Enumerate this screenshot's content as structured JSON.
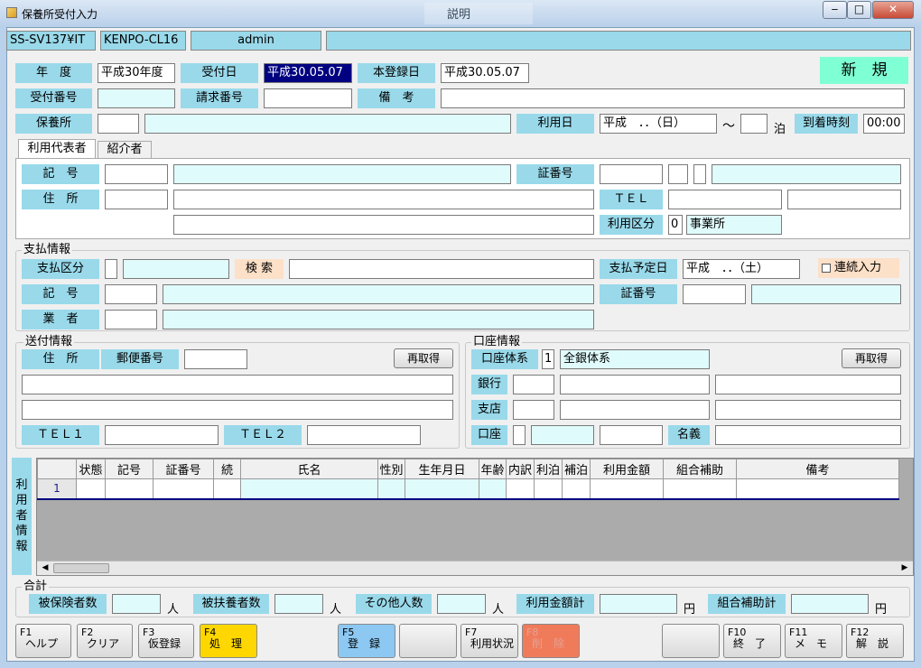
{
  "window": {
    "title": "保養所受付入力",
    "bg_text": "説明"
  },
  "status_bar": {
    "server": "SS-SV137¥IT",
    "client": "KENPO-CL16",
    "user": "admin"
  },
  "header": {
    "year_label": "年　度",
    "year_value": "平成30年度",
    "recv_date_label": "受付日",
    "recv_date_value": "平成30.05.07",
    "reg_date_label": "本登録日",
    "reg_date_value": "平成30.05.07",
    "mode_badge": "新　規",
    "recv_no_label": "受付番号",
    "claim_no_label": "請求番号",
    "note_label": "備　考",
    "facility_label": "保養所",
    "use_date_label": "利用日",
    "use_date_value": "平成　．．（日）",
    "tilde": "～",
    "nights_unit": "泊",
    "arrival_label": "到着時刻",
    "arrival_value": "00:00"
  },
  "tabs": [
    "利用代表者",
    "紹介者"
  ],
  "representative": {
    "symbol_label": "記　号",
    "cert_label": "証番号",
    "address_label": "住　所",
    "tel_label": "ＴＥＬ",
    "use_type_label": "利用区分",
    "use_type_code": "0",
    "use_type_name": "事業所"
  },
  "payment": {
    "group_title": "支払情報",
    "pay_type_label": "支払区分",
    "search_label": "検 索",
    "sched_label": "支払予定日",
    "sched_value": "平成　．．（土）",
    "continuous_label": "連続入力",
    "symbol_label": "記　号",
    "cert_label": "証番号",
    "vendor_label": "業　者"
  },
  "shipping": {
    "group_title": "送付情報",
    "address_label": "住　所",
    "postal_label": "郵便番号",
    "refetch_label": "再取得",
    "tel1_label": "ＴＥＬ１",
    "tel2_label": "ＴＥＬ２"
  },
  "account": {
    "group_title": "口座情報",
    "system_label": "口座体系",
    "system_code": "1",
    "system_name": "全銀体系",
    "refetch_label": "再取得",
    "bank_label": "銀行",
    "branch_label": "支店",
    "account_label": "口座",
    "holder_label": "名義"
  },
  "users": {
    "side_label": "利用者情報",
    "columns": [
      "状態",
      "記号",
      "証番号",
      "続",
      "氏名",
      "性別",
      "生年月日",
      "年齢",
      "内訳",
      "利泊",
      "補泊",
      "利用金額",
      "組合補助",
      "備考"
    ],
    "rows": [
      {
        "no": "1"
      }
    ]
  },
  "totals": {
    "group_title": "合計",
    "insured_label": "被保険者数",
    "dependents_label": "被扶養者数",
    "others_label": "その他人数",
    "person_unit": "人",
    "amount_label": "利用金額計",
    "subsidy_label": "組合補助計",
    "yen_unit": "円"
  },
  "fkeys": [
    {
      "key": "F1",
      "label": "ヘルプ"
    },
    {
      "key": "F2",
      "label": "クリア"
    },
    {
      "key": "F3",
      "label": "仮登録"
    },
    {
      "key": "F4",
      "label": "処　理"
    },
    {
      "key": "F5",
      "label": "登　録"
    },
    {
      "key": "F7",
      "label": "利用状況"
    },
    {
      "key": "F8",
      "label": "削　除"
    },
    {
      "key": "F10",
      "label": "終　了"
    },
    {
      "key": "F11",
      "label": "メ　モ"
    },
    {
      "key": "F12",
      "label": "解　説"
    }
  ],
  "colors": {
    "accent": "#99d9ea",
    "highlight": "#ffd700",
    "f5": "#8cc8f2",
    "f8": "#f07b5b",
    "selected_date": "#000080"
  }
}
